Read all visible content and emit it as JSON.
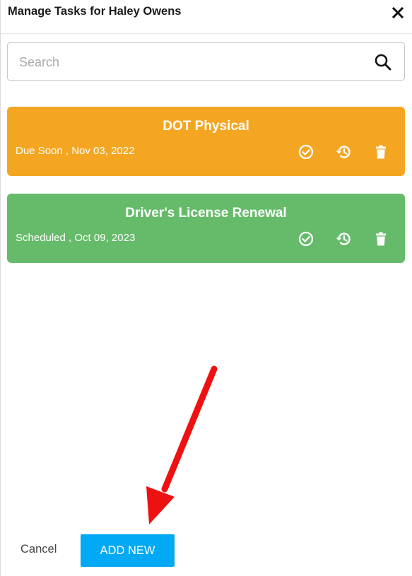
{
  "dialog": {
    "title": "Manage Tasks for Haley Owens",
    "close_icon": "close-icon"
  },
  "search": {
    "placeholder": "Search",
    "value": "",
    "icon": "search-icon"
  },
  "tasks": [
    {
      "title": "DOT Physical",
      "status": "Due Soon , Nov 03, 2022",
      "color": "#F4A623",
      "actions": [
        "check-circle-icon",
        "history-icon",
        "trash-icon"
      ]
    },
    {
      "title": "Driver's License Renewal",
      "status": "Scheduled , Oct 09, 2023",
      "color": "#66BB6A",
      "actions": [
        "check-circle-icon",
        "history-icon",
        "trash-icon"
      ]
    }
  ],
  "footer": {
    "cancel_label": "Cancel",
    "add_new_label": "ADD NEW",
    "add_new_color": "#03A9F4"
  },
  "annotation": {
    "arrow_color": "#EE1111"
  }
}
